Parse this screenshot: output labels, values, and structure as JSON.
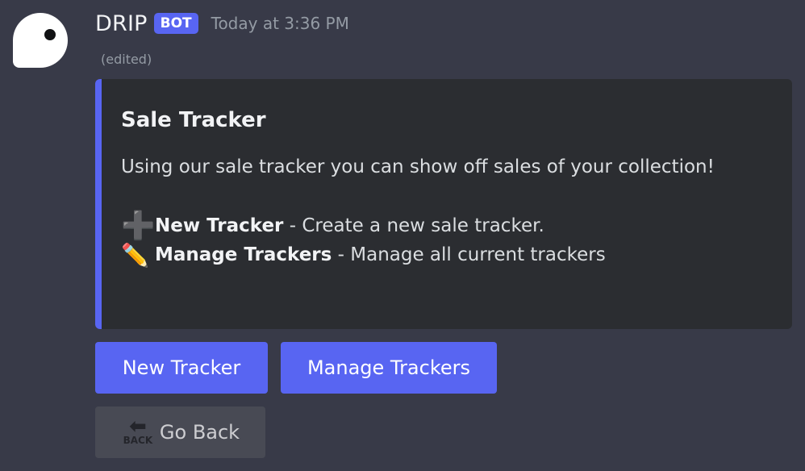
{
  "message": {
    "author": "DRIP",
    "bot_tag": "BOT",
    "timestamp": "Today at 3:36 PM",
    "edited": "(edited)"
  },
  "embed": {
    "accent_color": "#5865f2",
    "title": "Sale Tracker",
    "description": "Using our sale tracker you can show off sales of your collection!",
    "lines": [
      {
        "icon": "plus-icon",
        "label": "New Tracker",
        "text": "Create a new sale tracker."
      },
      {
        "icon": "pencil-icon",
        "label": "Manage Trackers",
        "text": "Manage all current trackers"
      }
    ]
  },
  "buttons": {
    "new_tracker": "New Tracker",
    "manage_trackers": "Manage Trackers",
    "go_back": "Go Back",
    "back_icon_text": "BACK"
  },
  "colors": {
    "blurple": "#5865f2",
    "background": "#383a48",
    "embed_bg": "#2b2d31"
  }
}
